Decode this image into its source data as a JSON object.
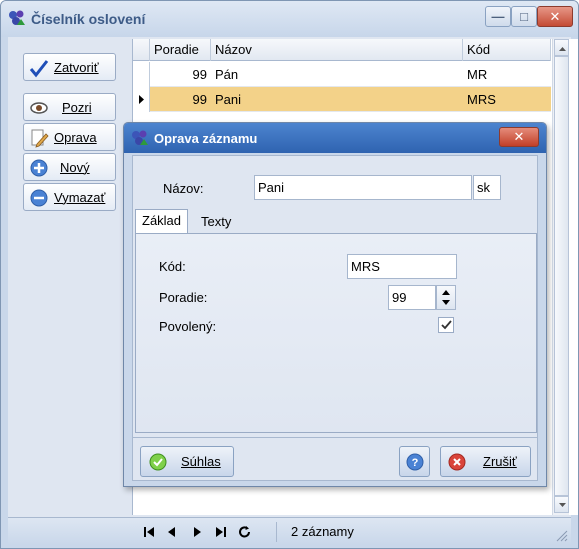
{
  "window": {
    "title": "Číselník oslovení",
    "min_glyph": "—",
    "max_glyph": "□",
    "close_glyph": "✕"
  },
  "toolbar": {
    "close_label": "Zatvoriť",
    "view_label": "Pozri",
    "edit_label": "Oprava",
    "new_label": "Nový",
    "delete_label": "Vymazať"
  },
  "grid": {
    "columns": [
      "Poradie",
      "Názov",
      "Kód"
    ],
    "rows": [
      {
        "poradie": "99",
        "nazov": "Pán",
        "kod": "MR"
      },
      {
        "poradie": "99",
        "nazov": "Pani",
        "kod": "MRS"
      }
    ],
    "selected_index": 1
  },
  "status": {
    "record_count": "2 záznamy"
  },
  "dialog": {
    "title": "Oprava záznamu",
    "name_label": "Názov:",
    "name_value": "Pani",
    "lang_value": "sk",
    "tabs": [
      "Základ",
      "Texty"
    ],
    "active_tab": 0,
    "code_label": "Kód:",
    "code_value": "MRS",
    "order_label": "Poradie:",
    "order_value": "99",
    "enabled_label": "Povolený:",
    "enabled_checked": true,
    "ok_label": "Súhlas",
    "cancel_label": "Zrušiť"
  },
  "colors": {
    "accent": "#2f63b0",
    "selected_row": "#f3d289",
    "close_red": "#c44b34"
  },
  "icons": [
    "app-icon",
    "checkmark-icon",
    "eye-icon",
    "pencil-icon",
    "plus-icon",
    "minus-icon",
    "help-icon",
    "cancel-icon",
    "ok-icon"
  ]
}
